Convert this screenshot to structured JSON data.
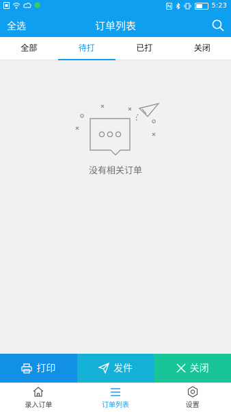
{
  "status_bar": {
    "time": "5:23"
  },
  "app_bar": {
    "select_all": "全选",
    "title": "订单列表"
  },
  "tabs": [
    {
      "label": "全部",
      "active": false
    },
    {
      "label": "待打",
      "active": true
    },
    {
      "label": "已打",
      "active": false
    },
    {
      "label": "关闭",
      "active": false
    }
  ],
  "empty_state": {
    "message": "没有相关订单"
  },
  "actions": {
    "print": "打印",
    "send": "发件",
    "close": "关闭"
  },
  "bottom_nav": [
    {
      "label": "录入订单",
      "icon": "home-icon"
    },
    {
      "label": "订单列表",
      "icon": "list-icon"
    },
    {
      "label": "设置",
      "icon": "gear-icon"
    }
  ],
  "colors": {
    "primary": "#0f9ff0",
    "print": "#1190e6",
    "send": "#15b0d5",
    "close": "#19c498",
    "background": "#f1f1f3"
  }
}
